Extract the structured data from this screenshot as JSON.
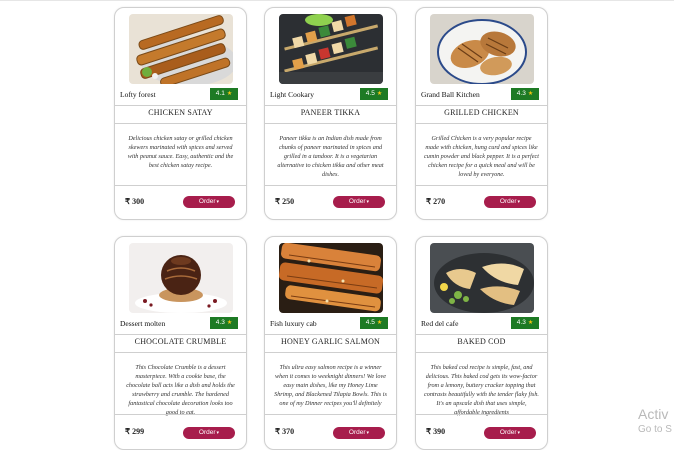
{
  "menu": {
    "items": [
      {
        "restaurant": "Lofty forest",
        "rating": "4.1",
        "title": "CHICKEN SATAY",
        "description": "Delicious chicken satay or grilled chicken skewers marinated with spices and served with peanut sauce. Easy, authentic and the best chicken satay recipe.",
        "price": "₹ 300",
        "order_label": "Order",
        "image_icon": "chicken-satay-image"
      },
      {
        "restaurant": "Light Cookary",
        "rating": "4.5",
        "title": "PANEER TIKKA",
        "description": "Paneer tikka is an Indian dish made from chunks of paneer marinated in spices and grilled in a tandoor. It is a vegetarian alternative to chicken tikka and other meat dishes.",
        "price": "₹ 250",
        "order_label": "Order",
        "image_icon": "paneer-tikka-image"
      },
      {
        "restaurant": "Grand Ball Kitchen",
        "rating": "4.3",
        "title": "GRILLED CHICKEN",
        "description": "Grilled Chicken is a very popular recipe made with chicken, hung curd and spices like cumin powder and black pepper. It is a perfect chicken recipe for a quick meal and will be loved by everyone.",
        "price": "₹ 270",
        "order_label": "Order",
        "image_icon": "grilled-chicken-image"
      },
      {
        "restaurant": "Dessert molten",
        "rating": "4.3",
        "title": "CHOCOLATE CRUMBLE",
        "description": "This Chocolate Crumble is a dessert masterpiece. With a cookie base, the chocolate ball acts like a dish and holds the strawberry and crumble. The hardened fantastical chocolate decoration looks too good to eat.",
        "price": "₹ 299",
        "order_label": "Order",
        "image_icon": "chocolate-crumble-image"
      },
      {
        "restaurant": "Fish luxury cab",
        "rating": "4.5",
        "title": "HONEY GARLIC SALMON",
        "description": "This ultra easy salmon recipe is a winner when it comes to weeknight dinners! We love easy main dishes, like my Honey Lime Shrimp, and Blackened Tilapia Bowls. This is one of my Dinner recipes you'll definitely",
        "price": "₹ 370",
        "order_label": "Order",
        "image_icon": "salmon-image"
      },
      {
        "restaurant": "Red del cafe",
        "rating": "4.3",
        "title": "BAKED COD",
        "description": "This baked cod recipe is simple, fast, and delicious. This baked cod gets its wow-factor from a lemony, buttery cracker topping that contrasts beautifully with the tender flaky fish. It's an upscale dish that uses simple, affordable ingredients",
        "price": "₹ 390",
        "order_label": "Order",
        "image_icon": "baked-cod-image"
      }
    ]
  },
  "watermark": {
    "line1": "Activ",
    "line2": "Go to S"
  },
  "colors": {
    "rating_badge": "#1d7a24",
    "order_button": "#a71d4c",
    "star": "#f1c40f"
  }
}
